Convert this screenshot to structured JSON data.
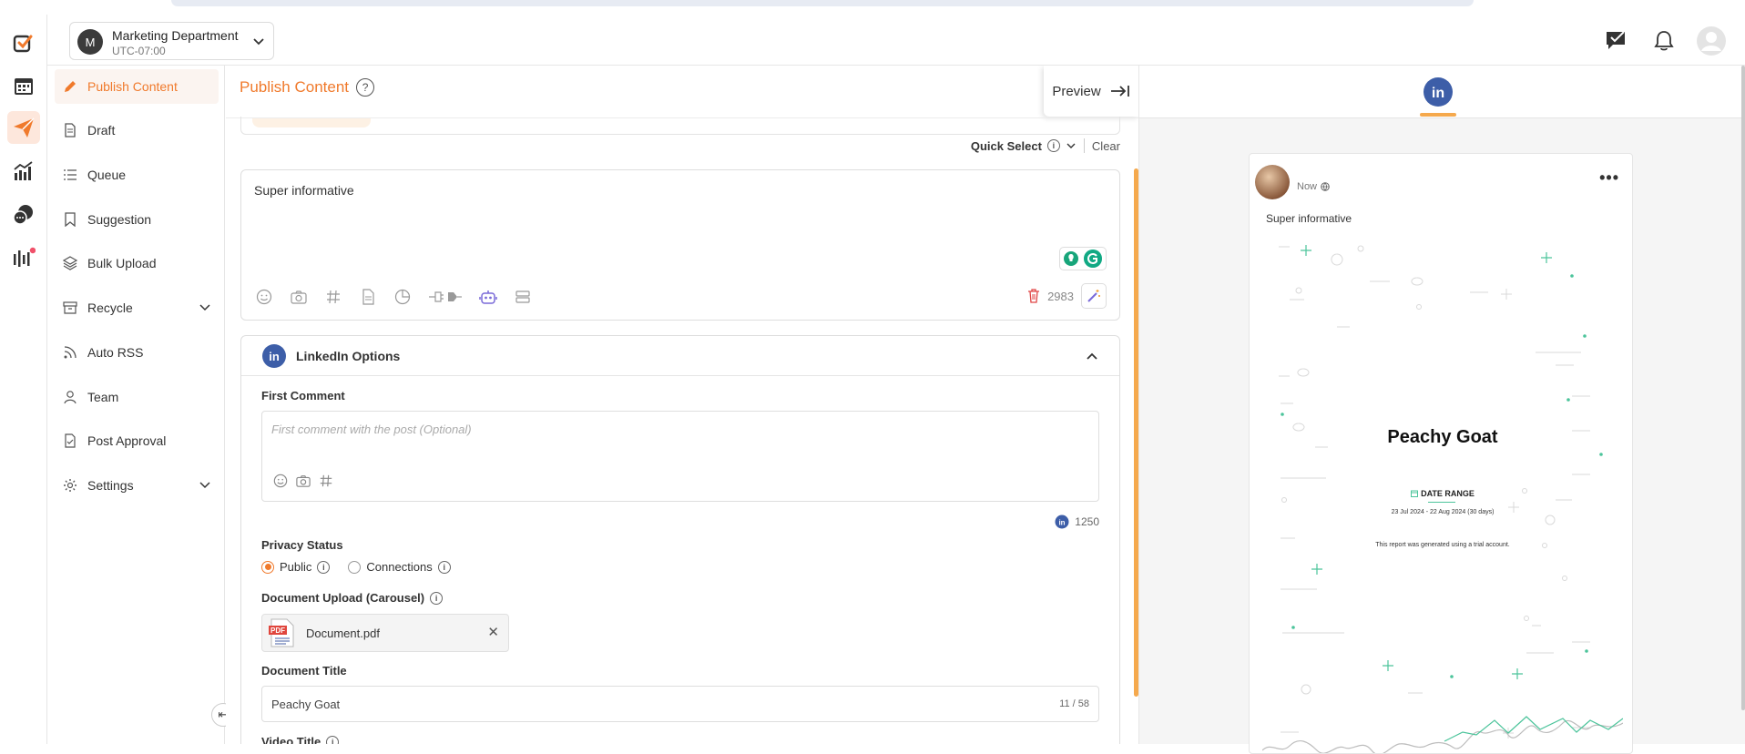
{
  "workspace": {
    "avatar_letter": "M",
    "name": "Marketing Department",
    "timezone": "UTC-07:00"
  },
  "rail": [
    "logo-icon",
    "calendar-icon",
    "send-icon",
    "analytics-icon",
    "chat-icon",
    "audio-icon"
  ],
  "sidebar": {
    "items": [
      {
        "label": "Publish Content",
        "icon": "pencil-icon",
        "active": true
      },
      {
        "label": "Draft",
        "icon": "document-icon"
      },
      {
        "label": "Queue",
        "icon": "list-icon"
      },
      {
        "label": "Suggestion",
        "icon": "bookmark-icon"
      },
      {
        "label": "Bulk Upload",
        "icon": "layers-icon"
      },
      {
        "label": "Recycle",
        "icon": "archive-icon",
        "has_submenu": true
      },
      {
        "label": "Auto RSS",
        "icon": "rss-icon"
      },
      {
        "label": "Team",
        "icon": "user-icon"
      },
      {
        "label": "Post Approval",
        "icon": "approval-icon"
      },
      {
        "label": "Settings",
        "icon": "gear-icon",
        "has_submenu": true
      }
    ]
  },
  "composer": {
    "title": "Publish Content",
    "help_glyph": "?",
    "preview_label": "Preview",
    "quick_select_label": "Quick Select",
    "clear_label": "Clear",
    "post_text": "Super informative",
    "char_count": "2983",
    "linkedin": {
      "section_title": "LinkedIn Options",
      "first_comment_label": "First Comment",
      "first_comment_placeholder": "First comment with the post (Optional)",
      "first_comment_count": "1250",
      "privacy_label": "Privacy Status",
      "privacy_options": [
        "Public",
        "Connections"
      ],
      "privacy_selected": "Public",
      "doc_upload_label": "Document Upload (Carousel)",
      "doc_file_name": "Document.pdf",
      "doc_icon_text": "PDF",
      "doc_title_label": "Document Title",
      "doc_title_value": "Peachy Goat",
      "doc_title_count": "11 / 58",
      "video_title_label": "Video Title"
    }
  },
  "preview": {
    "network": "linkedin",
    "network_glyph": "in",
    "post_time": "Now",
    "post_text": "Super informative",
    "more_glyph": "•••",
    "document": {
      "title": "Peachy Goat",
      "range_label": "DATE RANGE",
      "range_value": "23 Jul 2024 - 22 Aug 2024 (30 days)",
      "note": "This report was generated using a trial account."
    }
  },
  "colors": {
    "accent": "#f07a2c",
    "linkedin": "#3d5ea8",
    "green": "#4cc49b",
    "scroll": "#f5a94d"
  }
}
